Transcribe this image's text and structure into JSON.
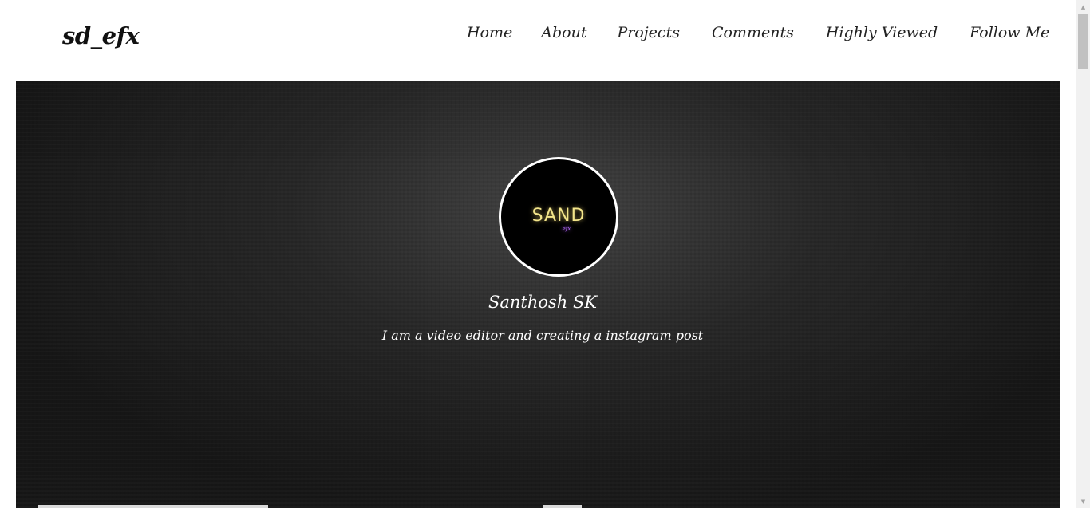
{
  "brand": "sd_efx",
  "nav": {
    "home": "Home",
    "about": "About",
    "projects": "Projects",
    "comments": "Comments",
    "highly_viewed": "Highly Viewed",
    "follow_me": "Follow Me"
  },
  "hero": {
    "logo_main": "SAND",
    "logo_sub": "efx",
    "name": "Santhosh SK",
    "tagline": "I am a video editor and creating a instagram post"
  },
  "scrollbar": {
    "up_glyph": "▲",
    "down_glyph": "▼"
  },
  "colors": {
    "logo_gold": "#f3e58a",
    "logo_purple": "#b86bff",
    "hero_bg": "#151515"
  }
}
